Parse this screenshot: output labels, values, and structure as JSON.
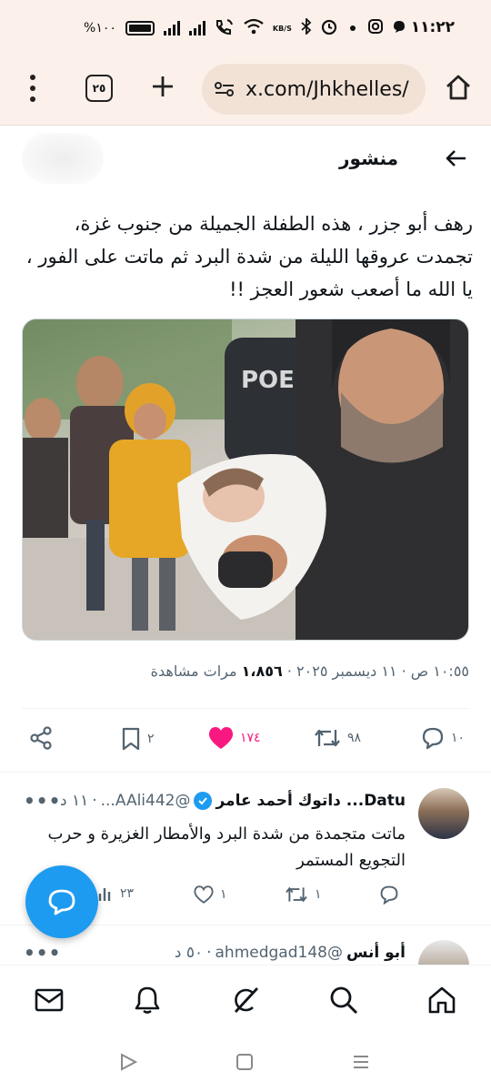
{
  "status_bar": {
    "time": "١١:٢٢",
    "battery": "%١٠٠",
    "data_speed": "KB/S",
    "icons": [
      "battery-icon",
      "signal-icon",
      "signal-icon",
      "wifi-calling-icon",
      "wifi-icon",
      "bluetooth-icon",
      "alarm-icon",
      "dot-icon",
      "instagram-icon",
      "chat-icon"
    ]
  },
  "browser": {
    "url": "x.com/Jhkhelles/",
    "tab_count": "٢٥",
    "menu_icon": "more-vert-icon",
    "new_tab_icon": "plus-icon",
    "site_settings_icon": "tune-icon",
    "home_icon": "home-icon"
  },
  "post_header": {
    "title": "منشور",
    "back_icon": "arrow-left-icon"
  },
  "tweet": {
    "text": "رهف أبو جزر ، هذه الطفلة الجميلة من جنوب غزة، تجمدت عروقها الليلة من شدة البرد ثم ماتت على الفور ، يا الله ما أصعب شعور العجز !!",
    "meta_time": "١٠:٥٥ ص · ١١ ديسمبر ٢٠٢٥ · ",
    "views_count": "١،٨٥٦",
    "views_label": " مرات مشاهدة",
    "actions": {
      "replies": "١٠",
      "retweets": "٩٨",
      "likes": "١٧٤",
      "bookmarks": "٢"
    },
    "like_color": "#f91880"
  },
  "replies": [
    {
      "name": "Datu... داتوك أحمد عامر",
      "handle": "@AAli442...",
      "time": "١١ د",
      "text": "ماتت متجمدة من شدة البرد والأمطار الغزيرة و حرب التجويع المستمر",
      "actions": {
        "replies": "",
        "retweets": "١",
        "likes": "١",
        "views": "٢٣"
      }
    },
    {
      "name": "أبو أنس",
      "handle": "@ahmedgad148",
      "time": "٥٠ د"
    }
  ],
  "bottom_nav": [
    "mail-icon",
    "bell-icon",
    "grok-icon",
    "search-icon",
    "home-icon"
  ],
  "system_nav": [
    "back-triangle-icon",
    "home-square-icon",
    "recents-icon"
  ],
  "colors": {
    "accent": "#1d9bf0",
    "browser_bg": "#fcf1ea",
    "url_bar_bg": "#f2e2d6"
  }
}
